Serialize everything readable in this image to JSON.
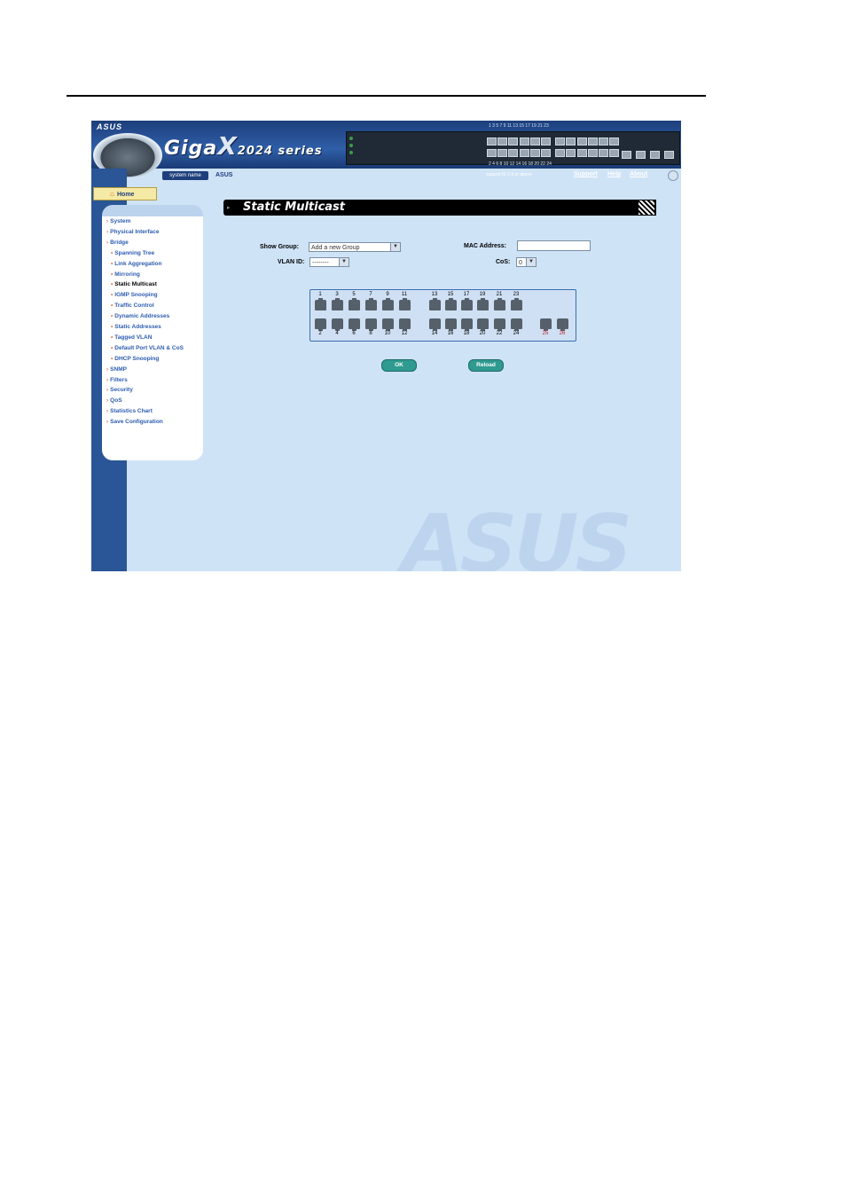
{
  "header": {
    "asus_logo": "ASUS",
    "brand_main": "Giga",
    "brand_x": "X",
    "brand_series": "2024 series",
    "system_name_label": "system name",
    "system_name_value": "ASUS",
    "panel_top_numbers": "1  3  5  7  9  11  13  15  17  19  21  23",
    "panel_bottom_numbers": "2  4  6  8  10  12  14  16  18  20  22  24",
    "support_text": "support IE 5.5 or above",
    "links": {
      "support": "Support",
      "help": "Help",
      "about": "About"
    }
  },
  "home_tab": "Home",
  "nav": {
    "items": [
      {
        "label": "System",
        "level": 0
      },
      {
        "label": "Physical Interface",
        "level": 0
      },
      {
        "label": "Bridge",
        "level": 0
      },
      {
        "label": "Spanning Tree",
        "level": 1
      },
      {
        "label": "Link Aggregation",
        "level": 1
      },
      {
        "label": "Mirroring",
        "level": 1
      },
      {
        "label": "Static Multicast",
        "level": 1,
        "active": true
      },
      {
        "label": "IGMP Snooping",
        "level": 1
      },
      {
        "label": "Traffic Control",
        "level": 1
      },
      {
        "label": "Dynamic Addresses",
        "level": 1
      },
      {
        "label": "Static Addresses",
        "level": 1
      },
      {
        "label": "Tagged VLAN",
        "level": 1
      },
      {
        "label": "Default Port VLAN & CoS",
        "level": 1
      },
      {
        "label": "DHCP Snooping",
        "level": 1
      },
      {
        "label": "SNMP",
        "level": 0
      },
      {
        "label": "Filters",
        "level": 0
      },
      {
        "label": "Security",
        "level": 0
      },
      {
        "label": "QoS",
        "level": 0
      },
      {
        "label": "Statistics Chart",
        "level": 0
      },
      {
        "label": "Save Configuration",
        "level": 0
      }
    ]
  },
  "page_title": "Static Multicast",
  "form": {
    "show_group_label": "Show Group:",
    "show_group_value": "Add a new Group",
    "mac_label": "MAC Address:",
    "mac_value": "",
    "vlan_label": "VLAN ID:",
    "vlan_value": "--------",
    "cos_label": "CoS:",
    "cos_value": "0"
  },
  "ports": {
    "top": [
      "1",
      "3",
      "5",
      "7",
      "9",
      "11",
      "13",
      "15",
      "17",
      "19",
      "21",
      "23"
    ],
    "bottom": [
      "2",
      "4",
      "6",
      "8",
      "10",
      "12",
      "14",
      "16",
      "18",
      "20",
      "22",
      "24"
    ],
    "uplink": [
      "25",
      "26"
    ]
  },
  "buttons": {
    "ok": "OK",
    "reload": "Reload"
  },
  "colors": {
    "header_blue": "#1d3f7c",
    "page_bg": "#cfe3f7",
    "nav_link": "#2c5cb0",
    "button": "#2f9a90",
    "uplink_label": "#c02020"
  }
}
